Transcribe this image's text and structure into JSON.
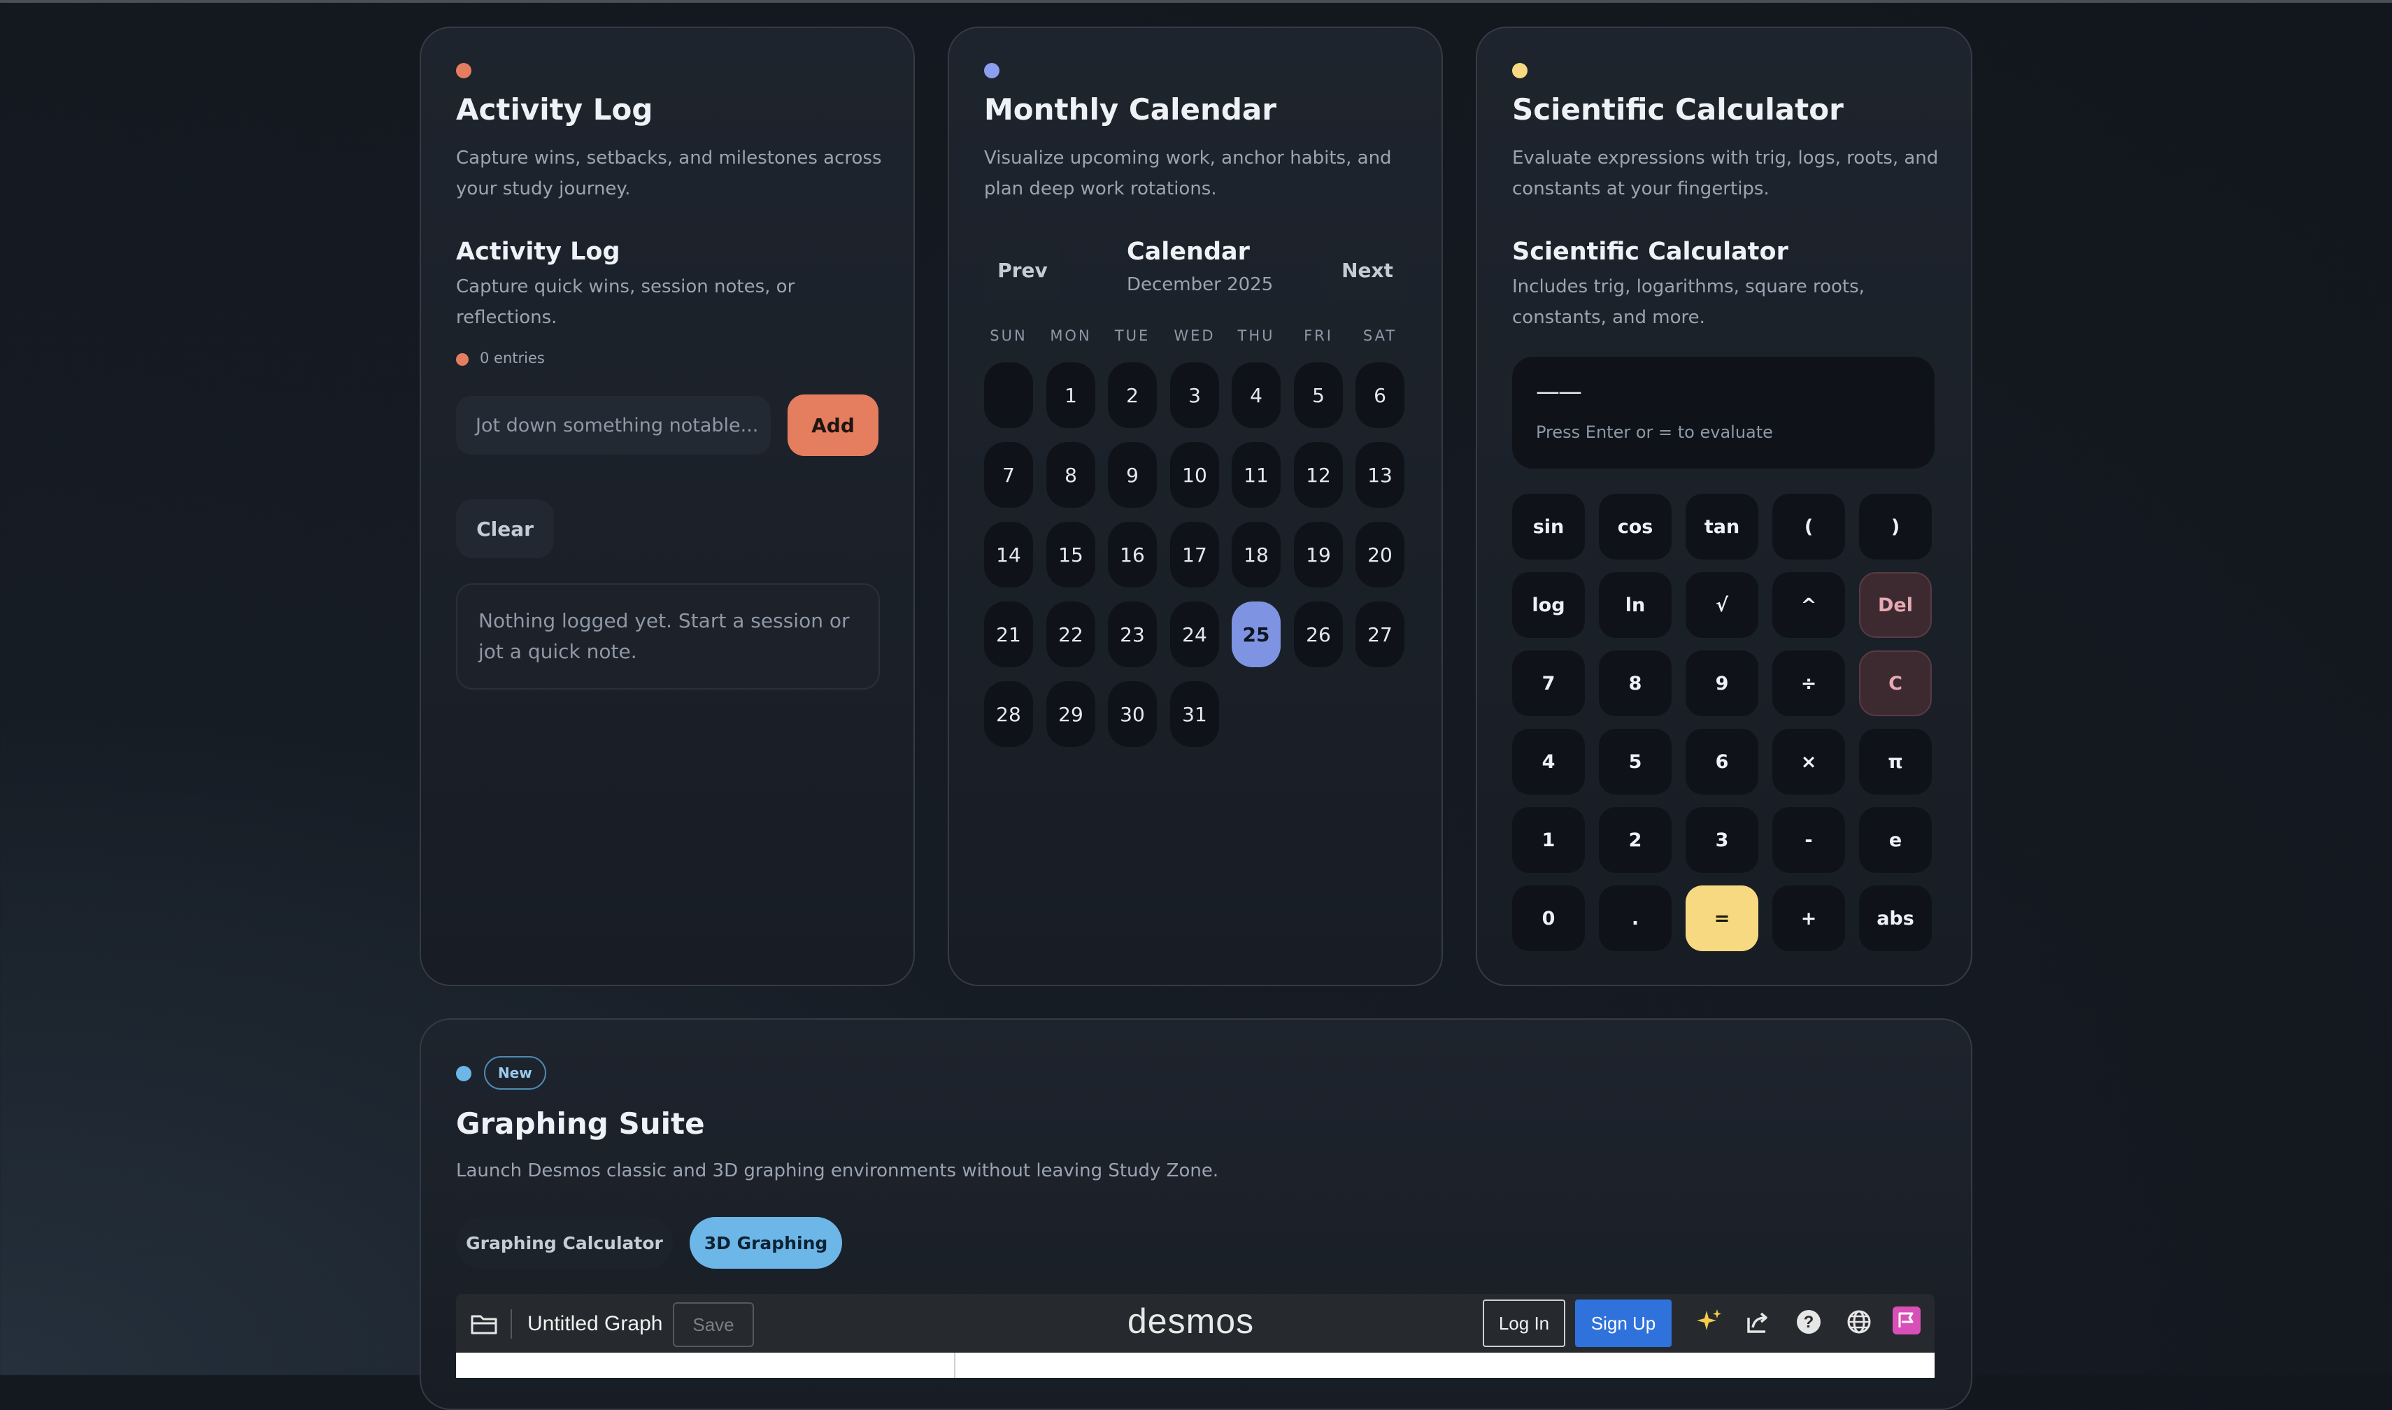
{
  "activity": {
    "title": "Activity Log",
    "description": "Capture wins, setbacks, and milestones across your study journey.",
    "panel_title": "Activity Log",
    "panel_description": "Capture quick wins, session notes, or reflections.",
    "entries_count": "0 entries",
    "input_placeholder": "Jot down something notable...",
    "add_label": "Add",
    "clear_label": "Clear",
    "empty_message": "Nothing logged yet. Start a session or jot a quick note.",
    "accent": "#e57d5f"
  },
  "calendar": {
    "title": "Monthly Calendar",
    "description": "Visualize upcoming work, anchor habits, and plan deep work rotations.",
    "prev_label": "Prev",
    "next_label": "Next",
    "heading": "Calendar",
    "month": "December 2025",
    "weekdays": [
      "SUN",
      "MON",
      "TUE",
      "WED",
      "THU",
      "FRI",
      "SAT"
    ],
    "days": [
      "1",
      "2",
      "3",
      "4",
      "5",
      "6",
      "7",
      "8",
      "9",
      "10",
      "11",
      "12",
      "13",
      "14",
      "15",
      "16",
      "17",
      "18",
      "19",
      "20",
      "21",
      "22",
      "23",
      "24",
      "25",
      "26",
      "27",
      "28",
      "29",
      "30",
      "31"
    ],
    "today": "25",
    "accent": "#8b9ef0"
  },
  "calculator": {
    "title": "Scientific Calculator",
    "description": "Evaluate expressions with trig, logs, roots, and constants at your fingertips.",
    "panel_title": "Scientific Calculator",
    "panel_description": "Includes trig, logarithms, square roots, constants, and more.",
    "display_value": "——",
    "display_hint": "Press Enter or = to evaluate",
    "keys": [
      "sin",
      "cos",
      "tan",
      "(",
      ")",
      "log",
      "ln",
      "√",
      "^",
      "Del",
      "7",
      "8",
      "9",
      "÷",
      "C",
      "4",
      "5",
      "6",
      "×",
      "π",
      "1",
      "2",
      "3",
      "-",
      "e",
      "0",
      ".",
      "=",
      "+",
      "abs"
    ],
    "accent": "#f6d981"
  },
  "graphing": {
    "badge": "New",
    "title": "Graphing Suite",
    "description": "Launch Desmos classic and 3D graphing environments without leaving Study Zone.",
    "tab_classic": "Graphing Calculator",
    "tab_3d": "3D Graphing",
    "active_tab": "3D Graphing",
    "accent": "#6cb6e8",
    "desmos": {
      "graph_title": "Untitled Graph",
      "save_label": "Save",
      "logo": "desmos",
      "login_label": "Log In",
      "signup_label": "Sign Up"
    }
  }
}
